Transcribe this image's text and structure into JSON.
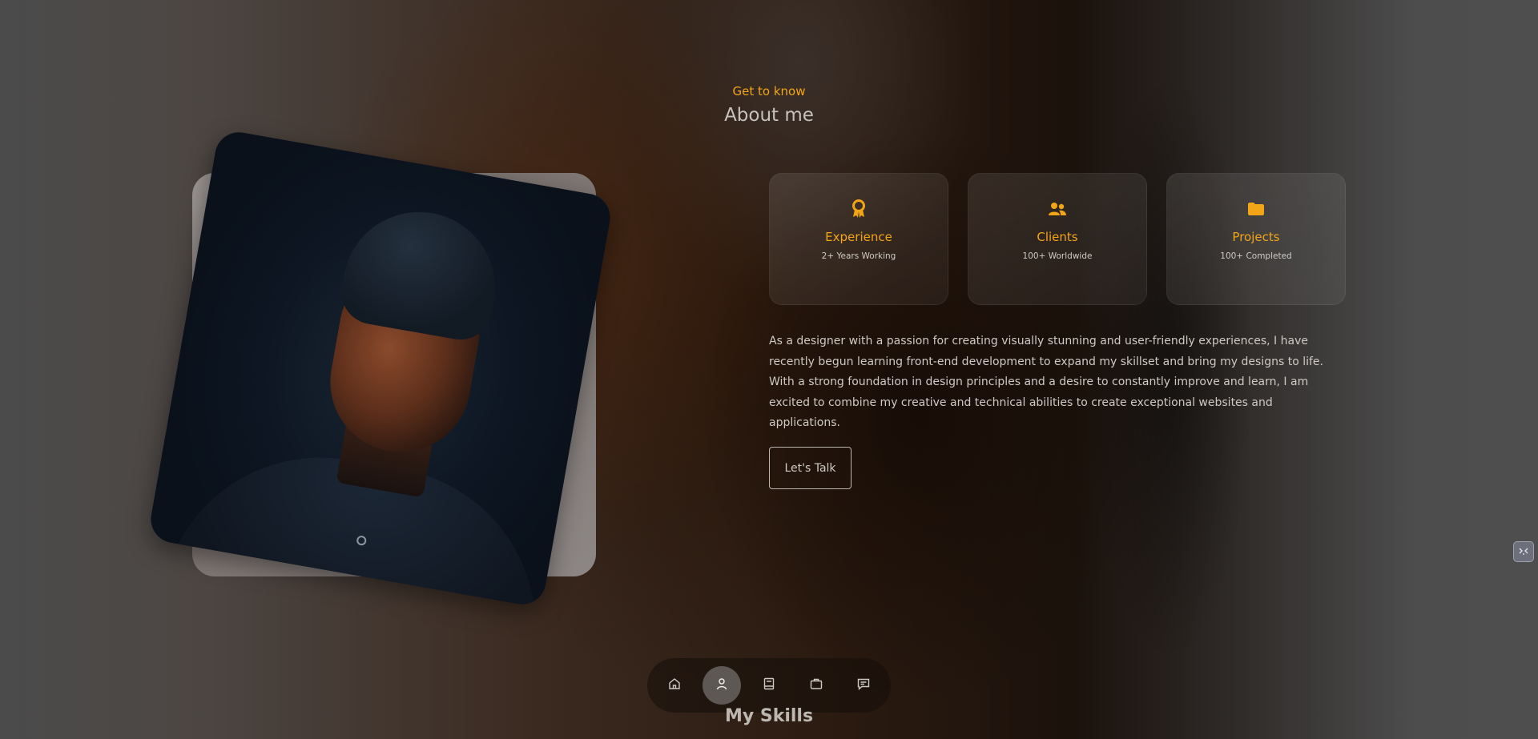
{
  "about": {
    "eyebrow": "Get to know",
    "title": "About me",
    "cards": [
      {
        "icon": "award-icon",
        "title": "Experience",
        "sub": "2+ Years Working"
      },
      {
        "icon": "users-icon",
        "title": "Clients",
        "sub": "100+ Worldwide"
      },
      {
        "icon": "folder-icon",
        "title": "Projects",
        "sub": "100+ Completed"
      }
    ],
    "bio": "As a designer with a passion for creating visually stunning and user-friendly experiences, I have recently begun learning front-end development to expand my skillset and bring my designs to life. With a strong foundation in design principles and a desire to constantly improve and learn, I am excited to combine my creative and technical abilities to create exceptional websites and applications.",
    "cta_label": "Let's Talk"
  },
  "nav": {
    "items": [
      {
        "name": "home-icon"
      },
      {
        "name": "user-icon",
        "active": true
      },
      {
        "name": "book-icon"
      },
      {
        "name": "briefcase-icon"
      },
      {
        "name": "message-icon"
      }
    ]
  },
  "next_section": {
    "title": "My Skills"
  },
  "colors": {
    "accent": "#f2a516",
    "text": "#cfc9c4",
    "nav_active": "#5e5854"
  }
}
